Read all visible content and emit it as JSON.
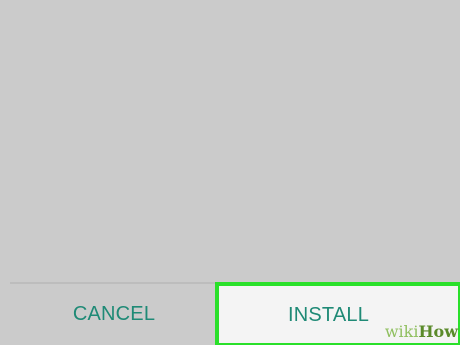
{
  "dialog": {
    "cancel_label": "CANCEL",
    "install_label": "INSTALL"
  },
  "watermark": {
    "wiki": "wiki",
    "how": "How"
  },
  "colors": {
    "background": "#cbcbcb",
    "button_text": "#1f8a76",
    "highlight_border": "#2ae02a",
    "install_background": "#f4f4f4"
  }
}
